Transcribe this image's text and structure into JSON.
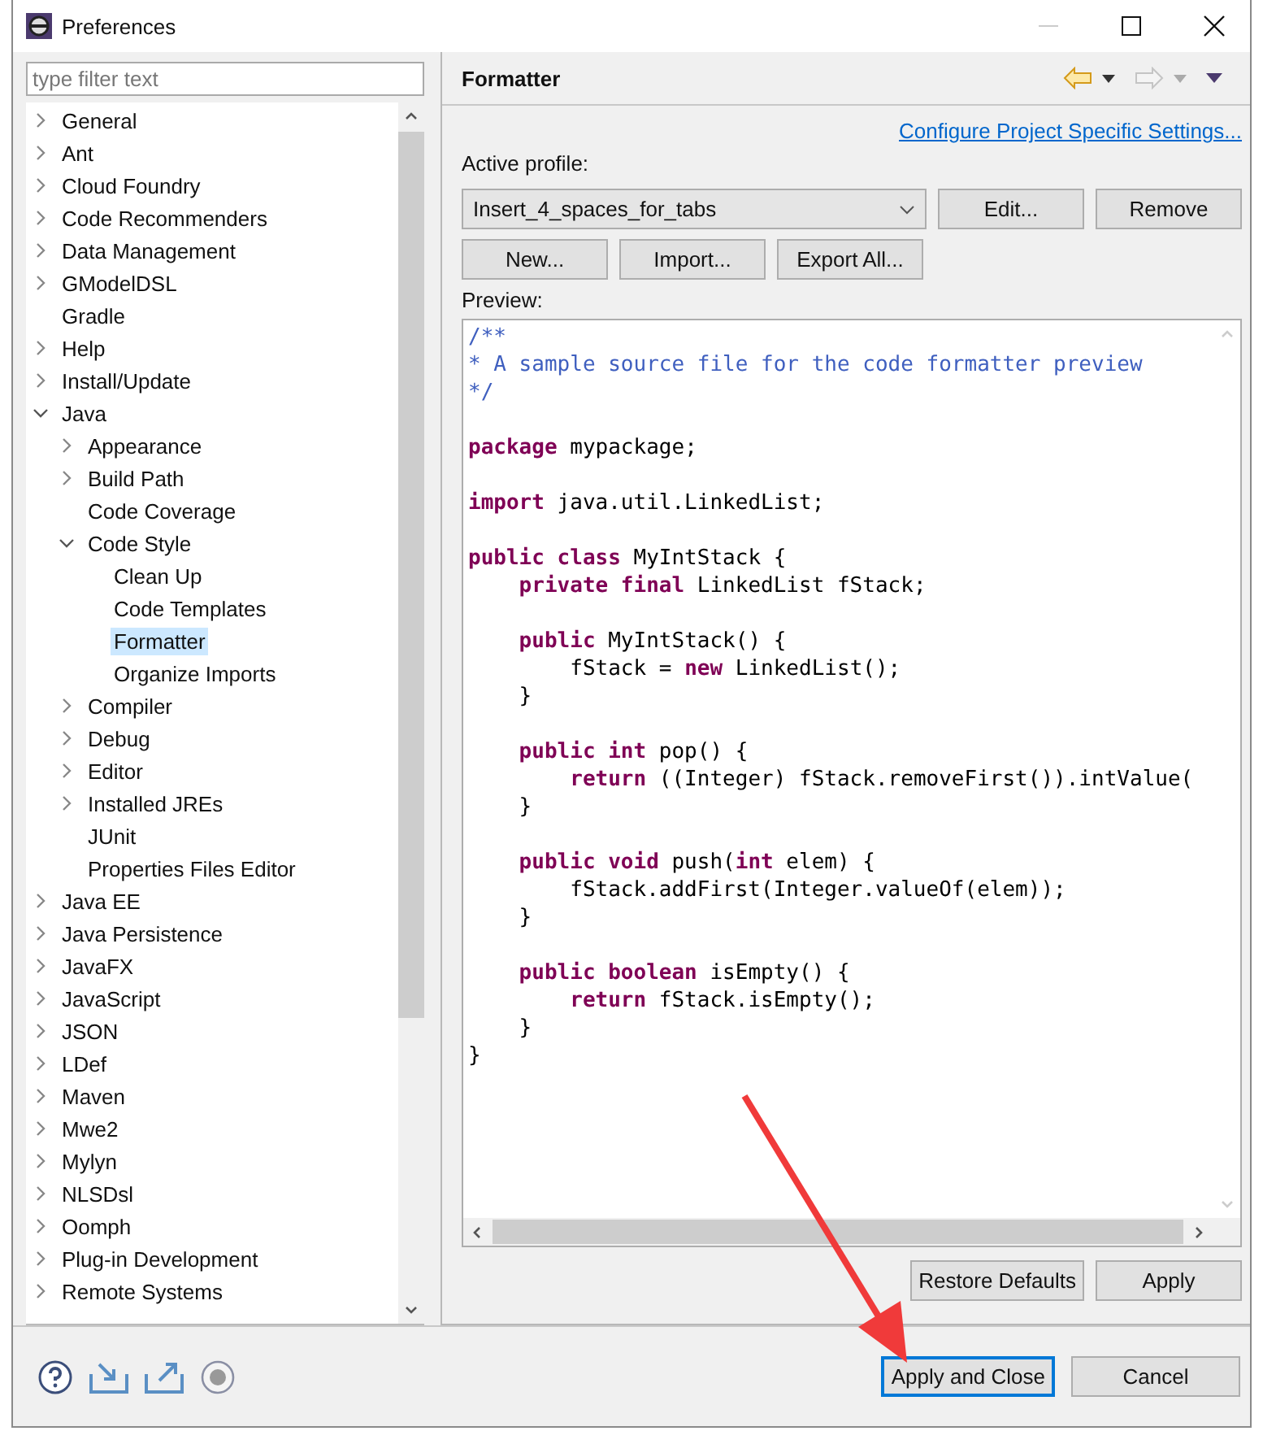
{
  "window": {
    "title": "Preferences"
  },
  "filter": {
    "placeholder": "type filter text"
  },
  "tree": [
    {
      "label": "General",
      "expanded": false,
      "selected": false
    },
    {
      "label": "Ant",
      "expanded": false,
      "selected": false
    },
    {
      "label": "Cloud Foundry",
      "expanded": false,
      "selected": false
    },
    {
      "label": "Code Recommenders",
      "expanded": false,
      "selected": false
    },
    {
      "label": "Data Management",
      "expanded": false,
      "selected": false
    },
    {
      "label": "GModelDSL",
      "expanded": false,
      "selected": false
    },
    {
      "label": "Gradle",
      "selected": false
    },
    {
      "label": "Help",
      "expanded": false,
      "selected": false
    },
    {
      "label": "Install/Update",
      "expanded": false,
      "selected": false
    },
    {
      "label": "Java",
      "expanded": true,
      "selected": false,
      "children": [
        {
          "label": "Appearance",
          "expanded": false,
          "selected": false
        },
        {
          "label": "Build Path",
          "expanded": false,
          "selected": false
        },
        {
          "label": "Code Coverage",
          "selected": false
        },
        {
          "label": "Code Style",
          "expanded": true,
          "selected": false,
          "children": [
            {
              "label": "Clean Up",
              "selected": false
            },
            {
              "label": "Code Templates",
              "selected": false
            },
            {
              "label": "Formatter",
              "selected": true
            },
            {
              "label": "Organize Imports",
              "selected": false
            }
          ]
        },
        {
          "label": "Compiler",
          "expanded": false,
          "selected": false
        },
        {
          "label": "Debug",
          "expanded": false,
          "selected": false
        },
        {
          "label": "Editor",
          "expanded": false,
          "selected": false
        },
        {
          "label": "Installed JREs",
          "expanded": false,
          "selected": false
        },
        {
          "label": "JUnit",
          "selected": false
        },
        {
          "label": "Properties Files Editor",
          "selected": false
        }
      ]
    },
    {
      "label": "Java EE",
      "expanded": false,
      "selected": false
    },
    {
      "label": "Java Persistence",
      "expanded": false,
      "selected": false
    },
    {
      "label": "JavaFX",
      "expanded": false,
      "selected": false
    },
    {
      "label": "JavaScript",
      "expanded": false,
      "selected": false
    },
    {
      "label": "JSON",
      "expanded": false,
      "selected": false
    },
    {
      "label": "LDef",
      "expanded": false,
      "selected": false
    },
    {
      "label": "Maven",
      "expanded": false,
      "selected": false
    },
    {
      "label": "Mwe2",
      "expanded": false,
      "selected": false
    },
    {
      "label": "Mylyn",
      "expanded": false,
      "selected": false
    },
    {
      "label": "NLSDsl",
      "expanded": false,
      "selected": false
    },
    {
      "label": "Oomph",
      "expanded": false,
      "selected": false
    },
    {
      "label": "Plug-in Development",
      "expanded": false,
      "selected": false
    },
    {
      "label": "Remote Systems",
      "expanded": false,
      "selected": false
    }
  ],
  "page": {
    "title": "Formatter",
    "link": "Configure Project Specific Settings...",
    "profile_label": "Active profile:",
    "profile": "Insert_4_spaces_for_tabs",
    "profile_buttons": [
      "Edit...",
      "Remove"
    ],
    "action_buttons": [
      "New...",
      "Import...",
      "Export All..."
    ],
    "preview_label": "Preview:",
    "code": [
      {
        "kind": "code",
        "tokens": [
          {
            "kind": "comment",
            "text": "/**"
          }
        ]
      },
      {
        "kind": "code",
        "tokens": [
          {
            "kind": "comment",
            "text": "* A sample source file for the code formatter preview"
          }
        ]
      },
      {
        "kind": "code",
        "tokens": [
          {
            "kind": "comment",
            "text": "*/"
          }
        ]
      },
      {
        "kind": "blank"
      },
      {
        "kind": "code",
        "tokens": [
          {
            "kind": "keyword",
            "text": "package"
          },
          {
            "kind": "plain",
            "text": " mypackage;"
          }
        ]
      },
      {
        "kind": "blank"
      },
      {
        "kind": "code",
        "tokens": [
          {
            "kind": "keyword",
            "text": "import"
          },
          {
            "kind": "plain",
            "text": " java.util.LinkedList;"
          }
        ]
      },
      {
        "kind": "blank"
      },
      {
        "kind": "code",
        "tokens": [
          {
            "kind": "keyword",
            "text": "public class"
          },
          {
            "kind": "plain",
            "text": " MyIntStack {"
          }
        ]
      },
      {
        "kind": "code",
        "tokens": [
          {
            "kind": "keyword",
            "text": "    private final"
          },
          {
            "kind": "plain",
            "text": " LinkedList fStack;"
          }
        ]
      },
      {
        "kind": "blank"
      },
      {
        "kind": "code",
        "tokens": [
          {
            "kind": "keyword",
            "text": "    public"
          },
          {
            "kind": "plain",
            "text": " MyIntStack() {"
          }
        ]
      },
      {
        "kind": "code",
        "tokens": [
          {
            "kind": "plain",
            "text": "        fStack = "
          },
          {
            "kind": "keyword",
            "text": "new"
          },
          {
            "kind": "plain",
            "text": " LinkedList();"
          }
        ]
      },
      {
        "kind": "code",
        "tokens": [
          {
            "kind": "plain",
            "text": "    }"
          }
        ]
      },
      {
        "kind": "blank"
      },
      {
        "kind": "code",
        "tokens": [
          {
            "kind": "keyword",
            "text": "    public int"
          },
          {
            "kind": "plain",
            "text": " pop() {"
          }
        ]
      },
      {
        "kind": "code",
        "tokens": [
          {
            "kind": "keyword",
            "text": "        return"
          },
          {
            "kind": "plain",
            "text": " ((Integer) fStack.removeFirst()).intValue("
          }
        ]
      },
      {
        "kind": "code",
        "tokens": [
          {
            "kind": "plain",
            "text": "    }"
          }
        ]
      },
      {
        "kind": "blank"
      },
      {
        "kind": "code",
        "tokens": [
          {
            "kind": "keyword",
            "text": "    public void"
          },
          {
            "kind": "plain",
            "text": " push("
          },
          {
            "kind": "keyword",
            "text": "int"
          },
          {
            "kind": "plain",
            "text": " elem) {"
          }
        ]
      },
      {
        "kind": "code",
        "tokens": [
          {
            "kind": "plain",
            "text": "        fStack.addFirst(Integer.valueOf(elem));"
          }
        ]
      },
      {
        "kind": "code",
        "tokens": [
          {
            "kind": "plain",
            "text": "    }"
          }
        ]
      },
      {
        "kind": "blank"
      },
      {
        "kind": "code",
        "tokens": [
          {
            "kind": "keyword",
            "text": "    public boolean"
          },
          {
            "kind": "plain",
            "text": " isEmpty() {"
          }
        ]
      },
      {
        "kind": "code",
        "tokens": [
          {
            "kind": "keyword",
            "text": "        return"
          },
          {
            "kind": "plain",
            "text": " fStack.isEmpty();"
          }
        ]
      },
      {
        "kind": "code",
        "tokens": [
          {
            "kind": "plain",
            "text": "    }"
          }
        ]
      },
      {
        "kind": "code",
        "tokens": [
          {
            "kind": "plain",
            "text": "}"
          }
        ]
      }
    ],
    "page_buttons": [
      "Restore Defaults",
      "Apply"
    ]
  },
  "footer_buttons": [
    {
      "label": "Apply and Close",
      "default": true
    },
    {
      "label": "Cancel",
      "default": false
    }
  ]
}
